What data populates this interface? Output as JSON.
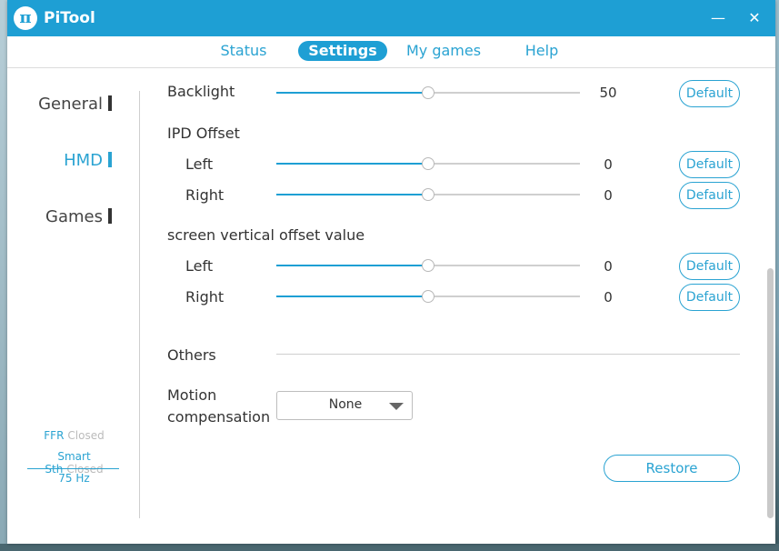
{
  "app": {
    "title": "PiTool",
    "logo_glyph": "π",
    "minimize_glyph": "—",
    "close_glyph": "✕"
  },
  "tabs": [
    {
      "label": "Status"
    },
    {
      "label": "Settings",
      "active": true
    },
    {
      "label": "My games"
    },
    {
      "label": "Help"
    }
  ],
  "sidebar": {
    "items": [
      {
        "label": "General"
      },
      {
        "label": "HMD",
        "active": true
      },
      {
        "label": "Games"
      }
    ],
    "status": {
      "ffr_key": "FFR",
      "ffr_val": "Closed",
      "smart_key": "Smart Sth",
      "smart_val": "Closed",
      "refresh": "75 Hz"
    }
  },
  "settings": {
    "backlight": {
      "label": "Backlight",
      "value": "50",
      "level": 0.5,
      "default_label": "Default"
    },
    "ipd": {
      "title": "IPD Offset",
      "left": {
        "label": "Left",
        "value": "0",
        "level": 0.5,
        "default_label": "Default"
      },
      "right": {
        "label": "Right",
        "value": "0",
        "level": 0.5,
        "default_label": "Default"
      }
    },
    "vertical": {
      "title": "screen vertical offset value",
      "left": {
        "label": "Left",
        "value": "0",
        "level": 0.5,
        "default_label": "Default"
      },
      "right": {
        "label": "Right",
        "value": "0",
        "level": 0.5,
        "default_label": "Default"
      }
    },
    "others": {
      "title": "Others"
    },
    "motion": {
      "label_line1": "Motion",
      "label_line2": "compensation",
      "selected": "None"
    },
    "restore_label": "Restore"
  },
  "colors": {
    "accent": "#1e9fd4",
    "titlebar": "#1e9fd4"
  }
}
